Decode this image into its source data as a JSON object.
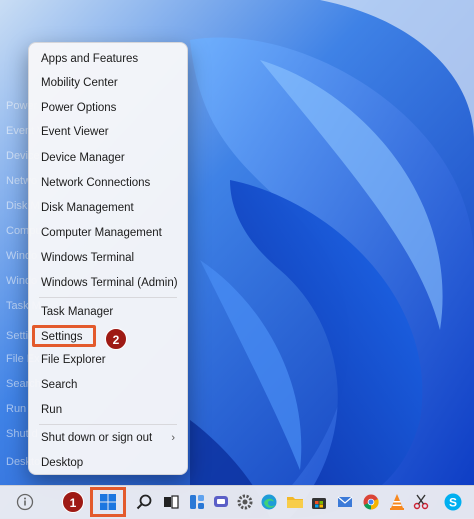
{
  "context_menu": {
    "items": [
      {
        "label": "Apps and Features"
      },
      {
        "label": "Mobility Center"
      },
      {
        "label": "Power Options"
      },
      {
        "label": "Event Viewer"
      },
      {
        "label": "Device Manager"
      },
      {
        "label": "Network Connections"
      },
      {
        "label": "Disk Management"
      },
      {
        "label": "Computer Management"
      },
      {
        "label": "Windows Terminal"
      },
      {
        "label": "Windows Terminal (Admin)"
      },
      {
        "label": "Task Manager"
      },
      {
        "label": "Settings"
      },
      {
        "label": "File Explorer"
      },
      {
        "label": "Search"
      },
      {
        "label": "Run"
      },
      {
        "label": "Shut down or sign out",
        "submenu_icon": "chevron-right-icon"
      },
      {
        "label": "Desktop"
      }
    ]
  },
  "ghost_menu": {
    "items": [
      "Power",
      "Event V",
      "Device",
      "Netwo",
      "Disk M",
      "Compu",
      "Windo",
      "Windo",
      "Task M",
      "Setti",
      "File Ex",
      "Search",
      "Run",
      "Shut d",
      "Deskto"
    ]
  },
  "callouts": {
    "step1": "1",
    "step2": "2"
  },
  "taskbar": {
    "icons": [
      "info-icon",
      "start-icon",
      "search-icon",
      "task-view-icon",
      "widgets-icon",
      "chat-icon",
      "settings-icon",
      "edge-icon",
      "file-explorer-icon",
      "store-icon",
      "chrome-icon",
      "vlc-icon",
      "snipping-icon",
      "skype-icon"
    ]
  },
  "colors": {
    "highlight": "#e35a2c",
    "badge": "#9e1a14",
    "wallpaper": "#1a5fd6"
  }
}
